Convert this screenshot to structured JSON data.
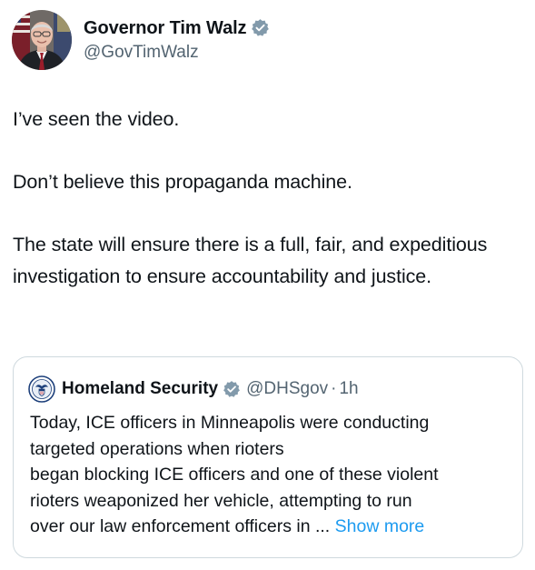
{
  "author": {
    "display_name": "Governor Tim Walz",
    "handle": "@GovTimWalz",
    "avatar_icon": "profile-photo",
    "verified_icon": "verified-badge-icon",
    "verified_color": "#829aab"
  },
  "tweet": {
    "paragraphs": [
      "I’ve seen the video.",
      "Don’t believe this propaganda machine.",
      "The state will ensure there is a full, fair, and expeditious investigation to ensure accountability and justice."
    ]
  },
  "quoted_tweet": {
    "display_name": "Homeland Security",
    "handle": "@DHSgov",
    "separator": "·",
    "time": "1h",
    "avatar_icon": "dhs-seal-icon",
    "verified_icon": "verified-badge-icon",
    "lines": [
      "Today, ICE officers in Minneapolis were conducting",
      "targeted operations when rioters",
      "began blocking ICE officers and one of these violent",
      "rioters weaponized her vehicle, attempting to run",
      "over our law enforcement officers in ..."
    ],
    "show_more_label": "Show more",
    "link_color": "#1d9bf0"
  }
}
